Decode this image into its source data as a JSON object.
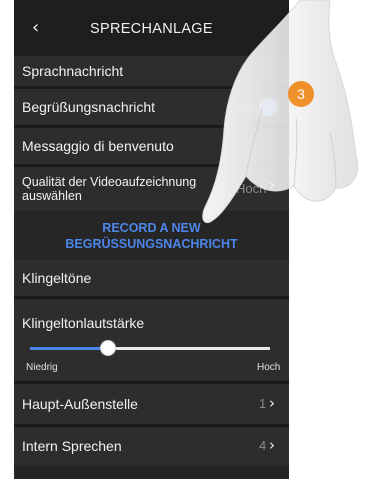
{
  "header": {
    "title": "SPRECHANLAGE",
    "back_icon": "‹"
  },
  "items": {
    "sprachnachricht": "Sprachnachricht",
    "begruessung": "Begrüßungsnachricht",
    "messaggio": "Messaggio di benvenuto",
    "qualitaet_line1": "Qualität der Videoaufzeichnung",
    "qualitaet_line2": "auswählen",
    "qualitaet_value": "Hoch",
    "record_line1": "RECORD A NEW",
    "record_line2": "BEGRÜSSUNGSNACHRICHT",
    "klingeltoene": "Klingeltöne",
    "klingelton_lautstaerke": "Klingeltonlautstärke",
    "slider_min": "Niedrig",
    "slider_max": "Hoch",
    "haupt_aussenstelle": "Haupt-Außenstelle",
    "haupt_aussenstelle_value": "1",
    "intern_sprechen": "Intern Sprechen",
    "intern_sprechen_value": "4"
  },
  "begruessung_toggle_on": true,
  "volume_level_percent": 32,
  "step_badge": "3",
  "colors": {
    "accent": "#4d86ea",
    "badge": "#f0902a",
    "background": "#262626"
  }
}
